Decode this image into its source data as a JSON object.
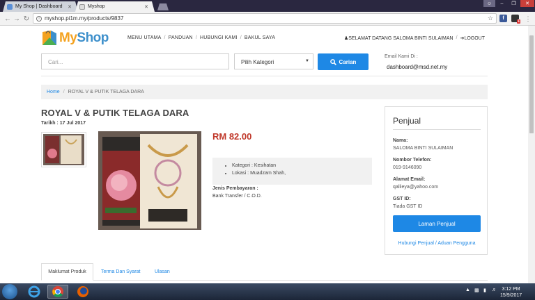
{
  "browser": {
    "tabs": [
      {
        "label": "My Shop | Dashboard",
        "active": false
      },
      {
        "label": "Myshop",
        "active": true
      }
    ],
    "url": "myshop.pi1m.my/products/9837",
    "extension_badge": "1"
  },
  "header": {
    "logo_my": "My",
    "logo_shop": "Shop",
    "nav": [
      "MENU UTAMA",
      "PANDUAN",
      "HUBUNGI KAMI",
      "BAKUL SAYA"
    ],
    "nav_sep": "/",
    "welcome": "SELAMAT DATANG SALOMA BINTI SULAIMAN",
    "logout": "LOGOUT"
  },
  "search": {
    "placeholder": "Cari...",
    "category_selected": "Pilih Kategori",
    "button_label": "Carian",
    "email_label": "Email Kami Di :",
    "email": "dashboard@msd.net.my"
  },
  "breadcrumb": {
    "home": "Home",
    "sep": "/",
    "current": "ROYAL V & PUTIK TELAGA DARA"
  },
  "product": {
    "title": "ROYAL V & PUTIK TELAGA DARA",
    "date": "Tarikh : 17 Jul 2017",
    "price": "RM 82.00",
    "category": "Kategori : Kesihatan",
    "location": "Lokasi : Muadzam Shah,",
    "payment_label": "Jenis Pembayaran :",
    "payment_value": "Bank Transfer / C.O.D."
  },
  "seller": {
    "heading": "Penjual",
    "name_label": "Nama:",
    "name": "SALOMA BINTI SULAIMAN",
    "phone_label": "Nombor Telefon:",
    "phone": "019-9146090",
    "email_label": "Alamat Email:",
    "email": "qallieya@yahoo.com",
    "gst_label": "GST ID:",
    "gst": "Tiada GST ID",
    "button": "Laman Penjual",
    "link": "Hubungi Penjual / Aduan Pengguna"
  },
  "tabs": [
    "Maklumat Produk",
    "Terma Dan Syarat",
    "Ulasan"
  ],
  "taskbar": {
    "time": "3:12 PM",
    "date": "15/9/2017"
  },
  "colors": {
    "accent": "#1e88e5",
    "price": "#c0392b",
    "logo_orange": "#f4a21f",
    "logo_blue": "#3d8fcb"
  }
}
